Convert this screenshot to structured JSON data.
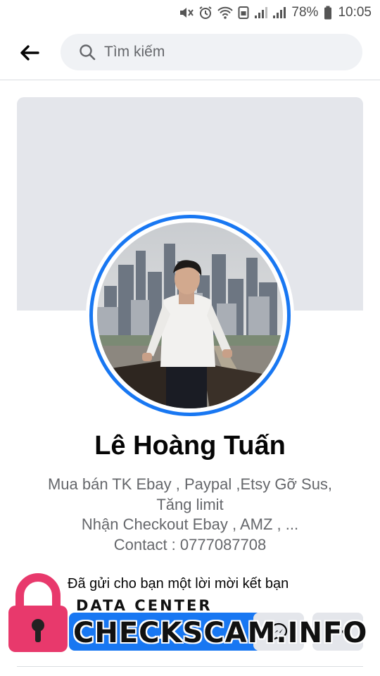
{
  "status_bar": {
    "icons": [
      "mute-icon",
      "alarm-icon",
      "wifi-icon",
      "data-icon",
      "signal-icon",
      "signal-icon",
      "battery-icon"
    ],
    "battery": "78%",
    "time": "10:05"
  },
  "top_bar": {
    "back_icon": "back-arrow-icon",
    "search_icon": "search-icon",
    "search_placeholder": "Tìm kiếm"
  },
  "profile": {
    "name": "Lê Hoàng Tuấn",
    "bio_lines": [
      "Mua bán TK Ebay , Paypal ,Etsy Gỡ Sus,",
      "Tăng limit",
      "Nhận Checkout Ebay , AMZ , ...",
      "Contact : 0777087708"
    ],
    "friend_request_text": "Đã gửi cho bạn một lời mời kết bạn"
  },
  "actions": {
    "respond_icon": "person-icon",
    "messenger_icon": "messenger-icon",
    "more_icon": "more-icon"
  },
  "watermark": {
    "top": "DATA CENTER",
    "main": "CHECKSCAM.INFO",
    "lock_color": "#e8396c"
  },
  "colors": {
    "accent": "#1877f2",
    "cover": "#e4e6eb",
    "secondary_text": "#65676b"
  }
}
